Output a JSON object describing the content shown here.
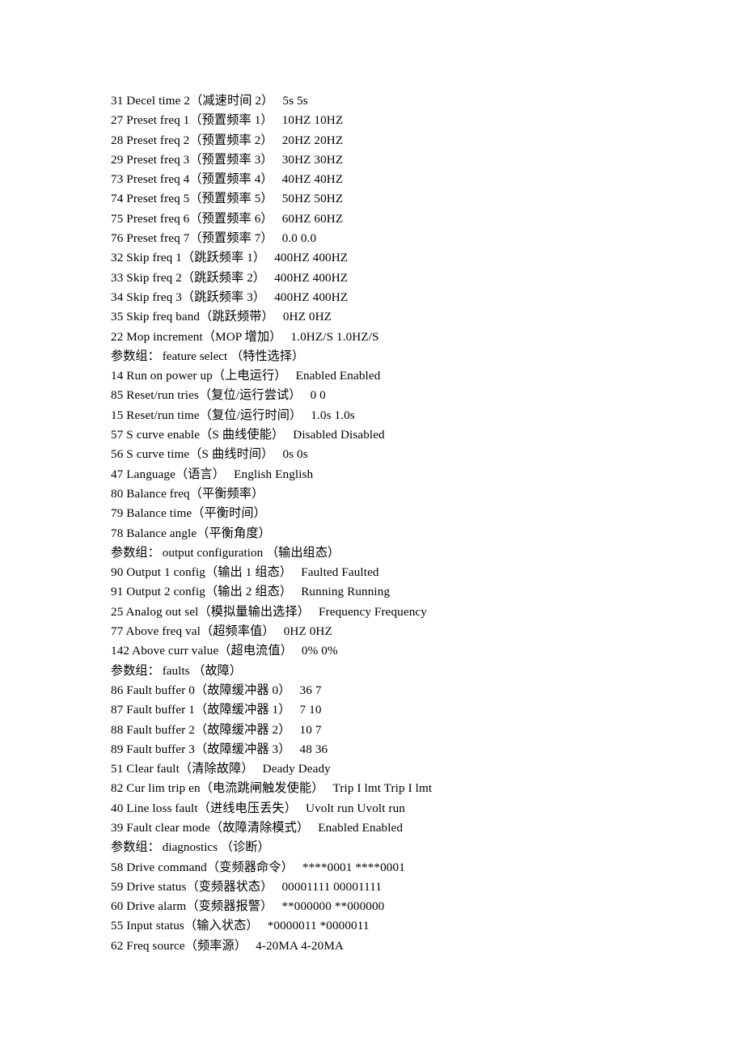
{
  "document": {
    "type": "parameter-table",
    "group_label": "参数组：",
    "lines": [
      {
        "kind": "param",
        "index": "31",
        "name": "Decel time 2",
        "cn": "（减速时间 2）",
        "value": "5s 5s"
      },
      {
        "kind": "param",
        "index": "27",
        "name": "Preset freq 1",
        "cn": "（预置频率 1）",
        "value": "10HZ 10HZ"
      },
      {
        "kind": "param",
        "index": "28",
        "name": "Preset freq 2",
        "cn": "（预置频率 2）",
        "value": "20HZ 20HZ"
      },
      {
        "kind": "param",
        "index": "29",
        "name": "Preset freq 3",
        "cn": "（预置频率 3）",
        "value": "30HZ 30HZ"
      },
      {
        "kind": "param",
        "index": "73",
        "name": "Preset freq 4",
        "cn": "（预置频率 4）",
        "value": "40HZ 40HZ"
      },
      {
        "kind": "param",
        "index": "74",
        "name": "Preset freq 5",
        "cn": "（预置频率 5）",
        "value": "50HZ 50HZ"
      },
      {
        "kind": "param",
        "index": "75",
        "name": "Preset freq 6",
        "cn": "（预置频率 6）",
        "value": "60HZ 60HZ"
      },
      {
        "kind": "param",
        "index": "76",
        "name": "Preset freq 7",
        "cn": "（预置频率 7）",
        "value": "0.0 0.0"
      },
      {
        "kind": "param",
        "index": "32",
        "name": "Skip freq 1",
        "cn": "（跳跃频率 1）",
        "value": "400HZ 400HZ"
      },
      {
        "kind": "param",
        "index": "33",
        "name": "Skip freq 2",
        "cn": "（跳跃频率 2）",
        "value": "400HZ 400HZ"
      },
      {
        "kind": "param",
        "index": "34",
        "name": "Skip freq 3",
        "cn": "（跳跃频率 3）",
        "value": "400HZ 400HZ"
      },
      {
        "kind": "param",
        "index": "35",
        "name": "Skip freq band",
        "cn": "（跳跃频带）",
        "value": "0HZ 0HZ"
      },
      {
        "kind": "param",
        "index": "22",
        "name": "Mop increment",
        "cn": "（MOP 增加）",
        "value": "1.0HZ/S 1.0HZ/S"
      },
      {
        "kind": "group",
        "group": "feature select",
        "group_cn": "（特性选择）"
      },
      {
        "kind": "param",
        "index": "14",
        "name": "Run on power up",
        "cn": "（上电运行）",
        "value": "Enabled Enabled"
      },
      {
        "kind": "param",
        "index": "85",
        "name": "Reset/run tries",
        "cn": "（复位/运行尝试）",
        "value": "0 0"
      },
      {
        "kind": "param",
        "index": "15",
        "name": "Reset/run time",
        "cn": "（复位/运行时间）",
        "value": "1.0s 1.0s"
      },
      {
        "kind": "param",
        "index": "57",
        "name": "S curve enable",
        "cn": "（S 曲线使能）",
        "value": "Disabled Disabled"
      },
      {
        "kind": "param",
        "index": "56",
        "name": "S curve time",
        "cn": "（S 曲线时间）",
        "value": "0s 0s"
      },
      {
        "kind": "param",
        "index": "47",
        "name": "Language",
        "cn": "（语言）",
        "value": "English English"
      },
      {
        "kind": "param",
        "index": "80",
        "name": "Balance freq",
        "cn": "（平衡频率）",
        "value": ""
      },
      {
        "kind": "param",
        "index": "79",
        "name": "Balance time",
        "cn": "（平衡时间）",
        "value": ""
      },
      {
        "kind": "param",
        "index": "78",
        "name": "Balance angle",
        "cn": "（平衡角度）",
        "value": ""
      },
      {
        "kind": "group",
        "group": "output configuration",
        "group_cn": "（输出组态）"
      },
      {
        "kind": "param",
        "index": "90",
        "name": "Output 1 config",
        "cn": "（输出 1 组态）",
        "value": "Faulted Faulted"
      },
      {
        "kind": "param",
        "index": "91",
        "name": "Output 2 config",
        "cn": "（输出 2 组态）",
        "value": "Running Running"
      },
      {
        "kind": "param",
        "index": "25",
        "name": "Analog out sel",
        "cn": "（模拟量输出选择）",
        "value": "Frequency Frequency"
      },
      {
        "kind": "param",
        "index": "77",
        "name": "Above freq val",
        "cn": "（超频率值）",
        "value": "0HZ 0HZ"
      },
      {
        "kind": "param",
        "index": "142",
        "name": "Above curr value",
        "cn": "（超电流值）",
        "value": "0% 0%"
      },
      {
        "kind": "group",
        "group": "faults",
        "group_cn": "（故障）"
      },
      {
        "kind": "param",
        "index": "86",
        "name": "Fault buffer 0",
        "cn": "（故障缓冲器 0）",
        "value": "36 7"
      },
      {
        "kind": "param",
        "index": "87",
        "name": "Fault buffer 1",
        "cn": "（故障缓冲器 1）",
        "value": "7 10"
      },
      {
        "kind": "param",
        "index": "88",
        "name": "Fault buffer 2",
        "cn": "（故障缓冲器 2）",
        "value": "10 7"
      },
      {
        "kind": "param",
        "index": "89",
        "name": "Fault buffer 3",
        "cn": "（故障缓冲器 3）",
        "value": "48 36"
      },
      {
        "kind": "param",
        "index": "51",
        "name": "Clear fault",
        "cn": "（清除故障）",
        "value": "Deady Deady"
      },
      {
        "kind": "param",
        "index": "82",
        "name": "Cur lim trip en",
        "cn": "（电流跳闸触发使能）",
        "value": "Trip I lmt Trip I lmt"
      },
      {
        "kind": "param",
        "index": "40",
        "name": "Line loss fault",
        "cn": "（进线电压丢失）",
        "value": "Uvolt run Uvolt run"
      },
      {
        "kind": "param",
        "index": "39",
        "name": "Fault clear mode",
        "cn": "（故障清除模式）",
        "value": "Enabled Enabled"
      },
      {
        "kind": "group",
        "group": "diagnostics",
        "group_cn": "（诊断）"
      },
      {
        "kind": "param",
        "index": "58",
        "name": "Drive command",
        "cn": "（变频器命令）",
        "value": "****0001 ****0001"
      },
      {
        "kind": "param",
        "index": "59",
        "name": "Drive status",
        "cn": "（变频器状态）",
        "value": "00001111 00001111"
      },
      {
        "kind": "param",
        "index": "60",
        "name": "Drive alarm",
        "cn": "（变频器报警）",
        "value": "**000000 **000000"
      },
      {
        "kind": "param",
        "index": "55",
        "name": "Input status",
        "cn": "（输入状态）",
        "value": "*0000011 *0000011"
      },
      {
        "kind": "param",
        "index": "62",
        "name": "Freq source",
        "cn": "（频率源）",
        "value": "4-20MA 4-20MA"
      }
    ]
  }
}
